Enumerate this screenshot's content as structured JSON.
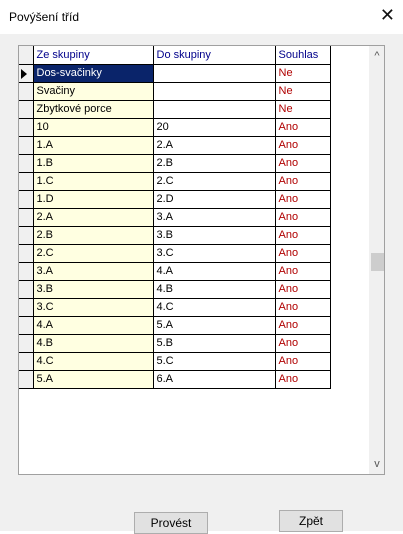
{
  "window": {
    "title": "Povýšení tříd",
    "close_glyph": "✕"
  },
  "grid": {
    "columns": [
      "Ze skupiny",
      "Do skupiny",
      "Souhlas"
    ],
    "rows": [
      {
        "from": "Dos-svačinky",
        "to": "",
        "agree": "Ne"
      },
      {
        "from": "Svačiny",
        "to": "",
        "agree": "Ne"
      },
      {
        "from": "Zbytkové porce",
        "to": "",
        "agree": "Ne"
      },
      {
        "from": "10",
        "to": "20",
        "agree": "Ano"
      },
      {
        "from": "1.A",
        "to": "2.A",
        "agree": "Ano"
      },
      {
        "from": "1.B",
        "to": "2.B",
        "agree": "Ano"
      },
      {
        "from": "1.C",
        "to": "2.C",
        "agree": "Ano"
      },
      {
        "from": "1.D",
        "to": "2.D",
        "agree": "Ano"
      },
      {
        "from": "2.A",
        "to": "3.A",
        "agree": "Ano"
      },
      {
        "from": "2.B",
        "to": "3.B",
        "agree": "Ano"
      },
      {
        "from": "2.C",
        "to": "3.C",
        "agree": "Ano"
      },
      {
        "from": "3.A",
        "to": "4.A",
        "agree": "Ano"
      },
      {
        "from": "3.B",
        "to": "4.B",
        "agree": "Ano"
      },
      {
        "from": "3.C",
        "to": "4.C",
        "agree": "Ano"
      },
      {
        "from": "4.A",
        "to": "5.A",
        "agree": "Ano"
      },
      {
        "from": "4.B",
        "to": "5.B",
        "agree": "Ano"
      },
      {
        "from": "4.C",
        "to": "5.C",
        "agree": "Ano"
      },
      {
        "from": "5.A",
        "to": "6.A",
        "agree": "Ano"
      }
    ]
  },
  "scrollbar": {
    "up_glyph": "^",
    "down_glyph": "v"
  },
  "buttons": {
    "run": "Provést",
    "back": "Zpět"
  },
  "colors": {
    "selection": "#0a246a",
    "source_column_bg": "#ffffe1",
    "header_text": "#00008b",
    "agree_text": "#b00000"
  }
}
